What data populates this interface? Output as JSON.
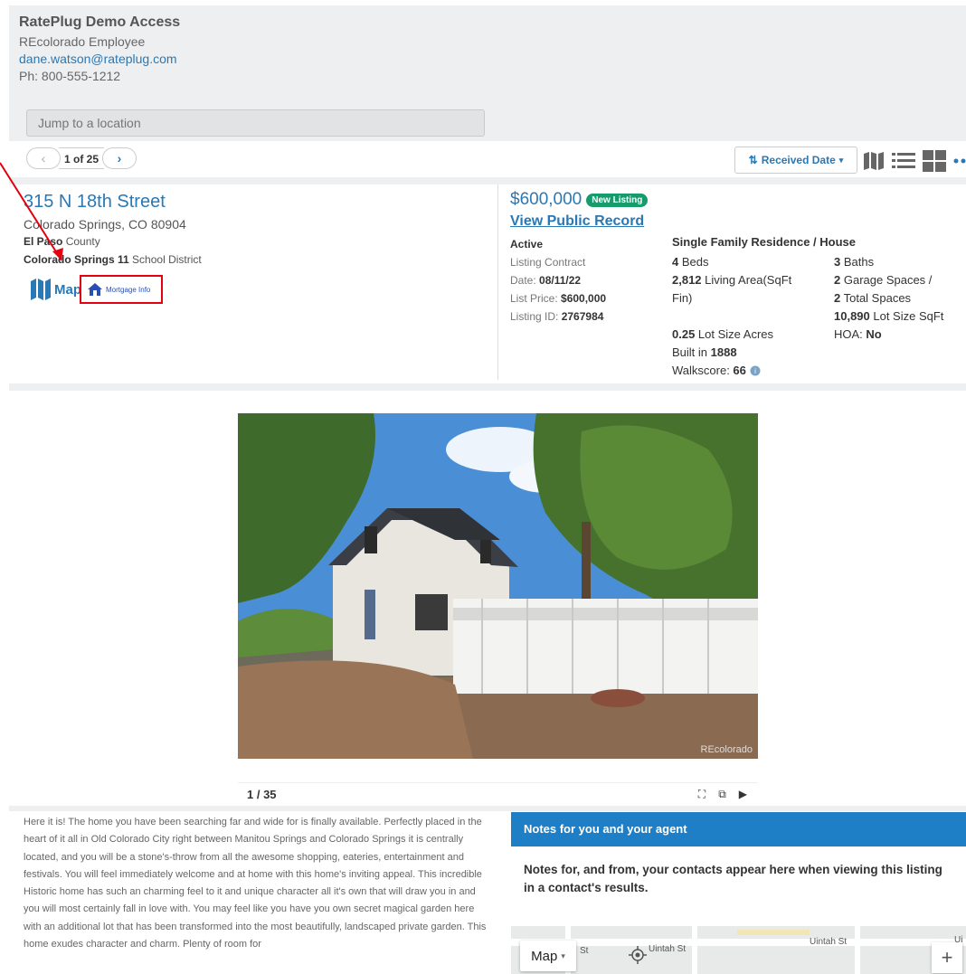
{
  "agent": {
    "name": "RatePlug Demo Access",
    "role": "REcolorado Employee",
    "email": "dane.watson@rateplug.com",
    "phone": "Ph: 800-555-1212"
  },
  "search": {
    "placeholder": "Jump to a location"
  },
  "pager": {
    "text": "1 of 25"
  },
  "sort": {
    "label": "Received Date"
  },
  "listing": {
    "address": "315 N 18th Street",
    "city": "Colorado Springs, CO 80904",
    "county_name": "El Paso",
    "county_suffix": " County",
    "school_name": "Colorado Springs 11",
    "school_suffix": " School District",
    "map_label": "Map",
    "mortgage_label": "Mortgage Info",
    "price": "$600,000",
    "badge": "New Listing",
    "public_record": "View Public Record",
    "status": "Active",
    "contract": "Listing Contract",
    "date_label": "Date: ",
    "date": "08/11/22",
    "list_price_label": "List Price: ",
    "list_price": "$600,000",
    "listing_id_label": "Listing ID: ",
    "listing_id": "2767984",
    "property_type": "Single Family Residence / House",
    "beds_num": "4",
    "beds_label": " Beds",
    "living_num": "2,812",
    "living_label": " Living Area(SqFt Fin)",
    "lot_acres_num": "0.25",
    "lot_acres_label": " Lot Size Acres",
    "built_label": "Built in ",
    "built": "1888",
    "walkscore_label": "Walkscore: ",
    "walkscore": "66",
    "baths_num": "3",
    "baths_label": " Baths",
    "garage_num": "2",
    "garage_label": " Garage Spaces / ",
    "total_num": "2",
    "total_label": " Total Spaces",
    "lot_sqft_num": "10,890",
    "lot_sqft_label": " Lot Size SqFt",
    "hoa_label": "HOA: ",
    "hoa": "No"
  },
  "photo": {
    "counter": "1 / 35",
    "watermark": "REcolorado"
  },
  "description": "Here it is! The home you have been searching far and wide for is finally available. Perfectly placed in the heart of it all in Old Colorado City right between Manitou Springs and Colorado Springs it is centrally located, and you will be a stone's-throw from all the awesome shopping, eateries, entertainment and festivals. You will feel immediately welcome and at home with this home's inviting appeal. This incredible Historic home has such an charming feel to it and unique character all it's own that will draw you in and you will most certainly fall in love with. You may feel like you have you own secret magical garden here with an additional lot that has been transformed into the most beautifully, landscaped private garden. This home exudes character and charm. Plenty of room for",
  "notes": {
    "title": "Notes for you and your agent",
    "body": "Notes for, and from, your contacts appear here when viewing this listing in a contact's results."
  },
  "map": {
    "button": "Map",
    "street1": "St",
    "street2": "Uintah St",
    "street3": "Uintah St",
    "street4": "Ui"
  },
  "colors": {
    "accent": "#2a78b4",
    "badge": "#169c6c",
    "notes_header": "#1e7fc6",
    "highlight": "#e3000f"
  }
}
